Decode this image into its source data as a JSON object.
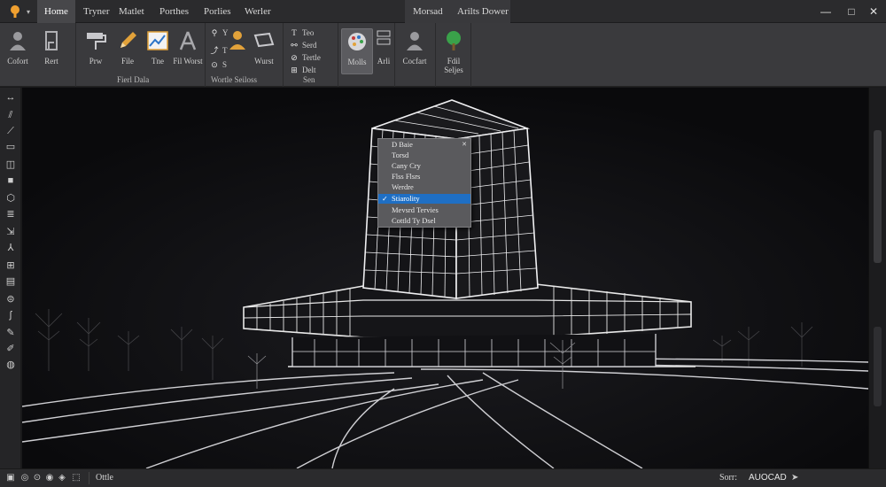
{
  "menu": {
    "tabs": [
      "Home",
      "Tryner",
      "Matlet",
      "Porthes",
      "Porlies",
      "Werler"
    ],
    "active_tab": 0,
    "right_tabs": [
      "Morsad",
      "Arilts Dower"
    ],
    "dropdown_glyph": "▾"
  },
  "window_controls": {
    "minimize": "—",
    "maximize": "□",
    "close": "✕"
  },
  "ribbon": {
    "group1": {
      "buttons": [
        "Cofort",
        "Rert"
      ]
    },
    "group2": {
      "buttons": [
        "Prw",
        "File",
        "Tne",
        "Fil Worst"
      ],
      "label": "Fierl Dala"
    },
    "group3": {
      "small": [
        "Y",
        "T",
        "S"
      ],
      "buttons": [
        "Wurst"
      ],
      "label": "Wortle Seiloss"
    },
    "group4": {
      "small": [
        "Teo",
        "Serd",
        "Tertle",
        "Delt"
      ],
      "label": "Sen"
    },
    "group5": {
      "buttons": [
        "Molls",
        "Arli"
      ]
    },
    "group6": {
      "buttons": [
        "Cocfart"
      ]
    },
    "group7": {
      "buttons": [
        "Fdil Seljes"
      ]
    }
  },
  "context_menu": {
    "items": [
      "D Baie",
      "Torsd",
      "Cany Cry",
      "Flss Flsrs",
      "Werdre",
      "Stiarolity",
      "Mevsrd Tervies",
      "Cottld Ty Dsel"
    ],
    "selected_index": 5,
    "checked_index": 5
  },
  "status": {
    "left_text": "Ottle",
    "right_label": "Sorr:",
    "right_value": "AUOCAD",
    "arrow": "➤"
  },
  "colors": {
    "accent": "#1f6fc4",
    "background": "#0d0d0f",
    "panel": "#3a3a3d",
    "wire": "#e8e8e8",
    "logo": "#f0a030",
    "tree_icon": "#3aa14a"
  },
  "icons": {
    "left_toolbar": [
      "move-icon",
      "line-icon",
      "polyline-icon",
      "rectangle-icon",
      "arc-icon",
      "circle-icon",
      "cube-icon",
      "hatch-icon",
      "dimension-icon",
      "text-icon",
      "grid-icon",
      "layer-icon",
      "measure-icon",
      "spline-icon",
      "brush-icon",
      "pen-icon",
      "globe-icon"
    ]
  }
}
